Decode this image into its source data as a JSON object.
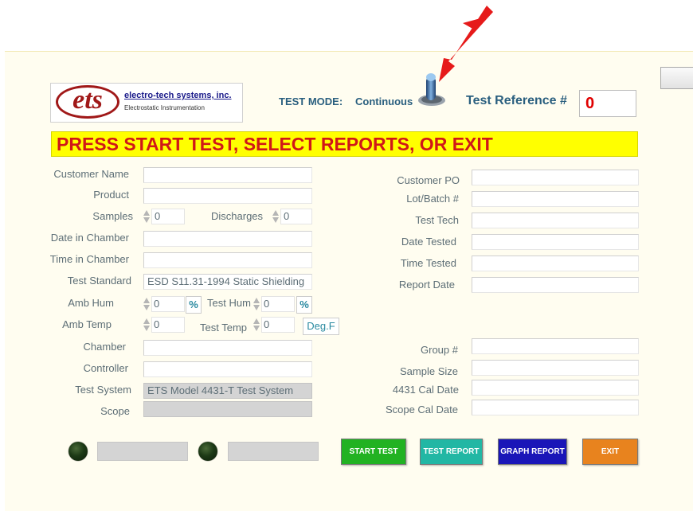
{
  "header": {
    "logo_text": "ets",
    "company_name": "electro-tech systems, inc.",
    "company_subtitle": "Electrostatic Instrumentation",
    "test_mode_label": "TEST MODE:",
    "test_mode_value": "Continuous",
    "test_reference_label": "Test Reference #",
    "test_reference_value": "0"
  },
  "banner": "PRESS START TEST, SELECT REPORTS, OR EXIT",
  "left_fields": {
    "customer_name": {
      "label": "Customer Name",
      "value": ""
    },
    "product": {
      "label": "Product",
      "value": ""
    },
    "samples": {
      "label": "Samples",
      "value": "0"
    },
    "discharges": {
      "label": "Discharges",
      "value": "0"
    },
    "date_in_chamber": {
      "label": "Date in Chamber",
      "value": ""
    },
    "time_in_chamber": {
      "label": "Time in Chamber",
      "value": ""
    },
    "test_standard": {
      "label": "Test Standard",
      "value": "ESD S11.31-1994 Static Shielding"
    },
    "amb_hum": {
      "label": "Amb Hum",
      "value": "0",
      "unit": "%"
    },
    "test_hum": {
      "label": "Test Hum",
      "value": "0",
      "unit": "%"
    },
    "amb_temp": {
      "label": "Amb Temp",
      "value": "0"
    },
    "test_temp": {
      "label": "Test Temp",
      "value": "0",
      "unit": "Deg.F"
    },
    "chamber": {
      "label": "Chamber",
      "value": ""
    },
    "controller": {
      "label": "Controller",
      "value": ""
    },
    "test_system": {
      "label": "Test System",
      "value": "ETS Model 4431-T Test System"
    },
    "scope": {
      "label": "Scope",
      "value": ""
    }
  },
  "right_fields": {
    "customer_po": {
      "label": "Customer PO",
      "value": ""
    },
    "lot_batch": {
      "label": "Lot/Batch #",
      "value": ""
    },
    "test_tech": {
      "label": "Test Tech",
      "value": ""
    },
    "date_tested": {
      "label": "Date Tested",
      "value": ""
    },
    "time_tested": {
      "label": "Time Tested",
      "value": ""
    },
    "report_date": {
      "label": "Report Date",
      "value": ""
    },
    "group": {
      "label": "Group #",
      "value": ""
    },
    "sample_size": {
      "label": "Sample Size",
      "value": ""
    },
    "cal_date_4431": {
      "label": "4431 Cal Date",
      "value": ""
    },
    "scope_cal_date": {
      "label": "Scope Cal Date",
      "value": ""
    }
  },
  "buttons": {
    "start_test": "START TEST",
    "test_report": "TEST REPORT",
    "graph_report": "GRAPH REPORT",
    "exit": "EXIT"
  },
  "colors": {
    "banner_bg": "#ffff00",
    "banner_text": "#d01818",
    "start_test": "#22b222",
    "test_report": "#22b7a4",
    "graph_report": "#1a16b8",
    "exit": "#e8831e",
    "arrow": "#e61a1a"
  }
}
